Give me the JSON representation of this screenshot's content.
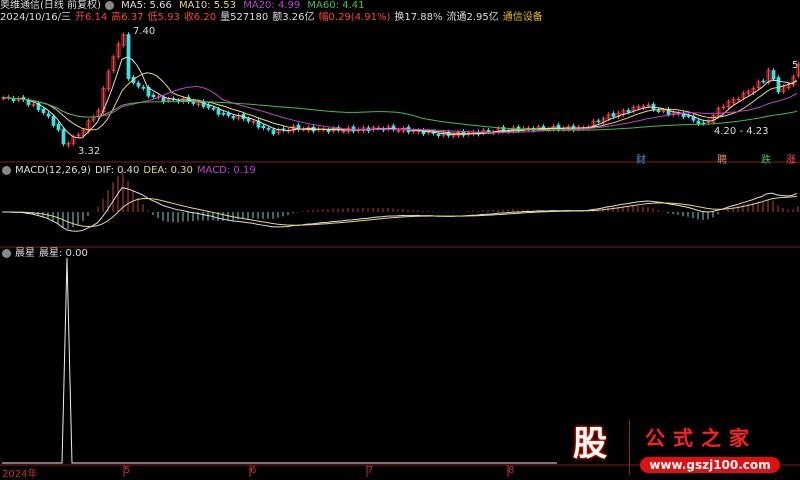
{
  "header": {
    "stock": "奥维通信(日线 前复权)",
    "ma": [
      {
        "label": "MA5: 5.66",
        "color": "#dddddd"
      },
      {
        "label": "MA10: 5.53",
        "color": "#e6d77a"
      },
      {
        "label": "MA20: 4.99",
        "color": "#c040d0"
      },
      {
        "label": "MA60: 4.41",
        "color": "#40c040"
      }
    ],
    "date": "2024/10/16/三",
    "open": "开6.14",
    "high": "高6.37",
    "low": "低5.93",
    "close": "收6.20",
    "volume": "量527180",
    "amount": "额3.26亿",
    "change": "幅0.29(4.91%)",
    "turnover": "换17.88%",
    "float": "流通2.95亿",
    "sector": "通信设备"
  },
  "macd_header": {
    "name": "MACD(12,26,9)",
    "dif": "DIF: 0.40",
    "dea": "DEA: 0.30",
    "macd": "MACD: 0.19"
  },
  "star_header": {
    "name": "晨星",
    "value": "晨星: 0.00"
  },
  "annotations": {
    "high": "7.40",
    "low": "3.32",
    "range": "4.20 - 4.23",
    "right": "5"
  },
  "tags": [
    {
      "text": "财",
      "color": "#5090e0"
    },
    {
      "text": "聘",
      "color": "#e09050"
    },
    {
      "text": "跌",
      "color": "#40c040"
    },
    {
      "text": "涨",
      "color": "#ff5050"
    }
  ],
  "axis": {
    "year": "2024年",
    "months": [
      "5",
      "6",
      "7",
      "8"
    ]
  },
  "logo": {
    "char": "股",
    "title": "公式之家",
    "url": "www.gszj100.com"
  },
  "chart_data": {
    "type": "candlestick",
    "price_range": [
      3.0,
      7.6
    ],
    "bars": 160,
    "close_keypoints": [
      [
        0,
        5.13
      ],
      [
        4,
        5.06
      ],
      [
        8,
        4.66
      ],
      [
        11,
        4.06
      ],
      [
        12,
        3.55
      ],
      [
        15,
        3.89
      ],
      [
        19,
        4.72
      ],
      [
        21,
        6.06
      ],
      [
        23,
        6.9
      ],
      [
        24,
        7.3
      ],
      [
        25,
        5.73
      ],
      [
        27,
        5.56
      ],
      [
        29,
        5.23
      ],
      [
        32,
        5.06
      ],
      [
        36,
        5.06
      ],
      [
        40,
        4.89
      ],
      [
        44,
        4.56
      ],
      [
        48,
        4.46
      ],
      [
        52,
        4.12
      ],
      [
        54,
        3.99
      ],
      [
        58,
        4.12
      ],
      [
        64,
        4.06
      ],
      [
        70,
        4.06
      ],
      [
        76,
        4.12
      ],
      [
        84,
        3.99
      ],
      [
        88,
        3.89
      ],
      [
        94,
        3.96
      ],
      [
        100,
        4.06
      ],
      [
        108,
        4.12
      ],
      [
        116,
        4.12
      ],
      [
        120,
        4.46
      ],
      [
        124,
        4.66
      ],
      [
        128,
        4.89
      ],
      [
        132,
        4.66
      ],
      [
        136,
        4.56
      ],
      [
        140,
        4.22
      ],
      [
        144,
        4.89
      ],
      [
        148,
        5.23
      ],
      [
        152,
        5.73
      ],
      [
        153,
        6.06
      ],
      [
        155,
        5.39
      ],
      [
        157,
        5.56
      ],
      [
        159,
        6.2
      ]
    ],
    "star_signal_index": 13
  }
}
